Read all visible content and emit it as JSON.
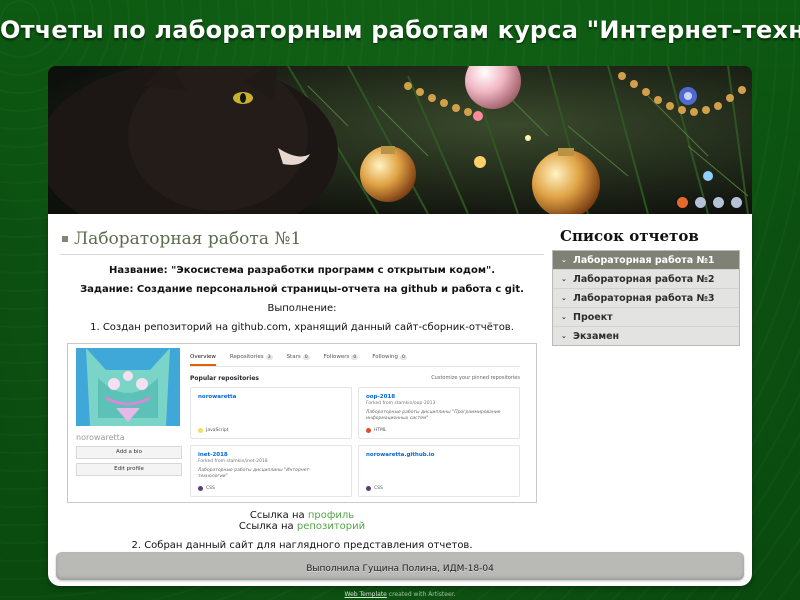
{
  "site": {
    "title": "Отчеты по лабораторным работам курса \"Интернет-технологии\"",
    "credit_link": "Web Template",
    "credit_rest": "created with Artisteer."
  },
  "banner": {
    "slides": 4,
    "active_slide": 1,
    "colors": {
      "active": "#e6682f",
      "inactive": "#b4c3d6"
    }
  },
  "article": {
    "title": "Лабораторная работа №1",
    "name_line": "Название: \"Экосистема разработки программ с открытым кодом\".",
    "task_line": "Задание: Создание персональной страницы-отчета на github и работа с git.",
    "execution": "Выполнение:",
    "step1": "1. Создан репозиторий на github.com, хранящий данный сайт-сборник-отчётов.",
    "profile_prefix": "Ссылка на",
    "profile_link": "профиль",
    "repo_prefix": "Ссылка на",
    "repo_link": "репозиторий",
    "step2": "2. Собран данный сайт для наглядного представления отчетов."
  },
  "github": {
    "username": "norowaretta",
    "add_bio": "Add a bio",
    "edit_profile": "Edit profile",
    "tabs": [
      {
        "label": "Overview",
        "count": ""
      },
      {
        "label": "Repositories",
        "count": "3"
      },
      {
        "label": "Stars",
        "count": "0"
      },
      {
        "label": "Followers",
        "count": "0"
      },
      {
        "label": "Following",
        "count": "0"
      }
    ],
    "popular": "Popular repositories",
    "customize": "Customize your pinned repositories",
    "repos": [
      {
        "name": "norowaretta",
        "fork": "",
        "desc": "",
        "lang": "JavaScript",
        "lang_color": "#f1e05a"
      },
      {
        "name": "oop-2018",
        "fork": "Forked from stamkin/oop-2013",
        "desc": "Лабораторные работы дисциплины \"Программирование информационных систем\"",
        "lang": "HTML",
        "lang_color": "#e34c26"
      },
      {
        "name": "inet-2018",
        "fork": "Forked from stamkin/inet-2018",
        "desc": "Лабораторные работы дисциплины \"Интернет-технологии\"",
        "lang": "CSS",
        "lang_color": "#563d7c"
      },
      {
        "name": "norowaretta.github.io",
        "fork": "",
        "desc": "",
        "lang": "CSS",
        "lang_color": "#563d7c"
      }
    ]
  },
  "sidebar": {
    "title": "Список отчетов",
    "items": [
      {
        "label": "Лабораторная работа №1",
        "active": true
      },
      {
        "label": "Лабораторная работа №2",
        "active": false
      },
      {
        "label": "Лабораторная работа №3",
        "active": false
      },
      {
        "label": "Проект",
        "active": false
      },
      {
        "label": "Экзамен",
        "active": false
      }
    ]
  },
  "footer": {
    "text": "Выполнила Гущина Полина, ИДМ-18-04"
  }
}
